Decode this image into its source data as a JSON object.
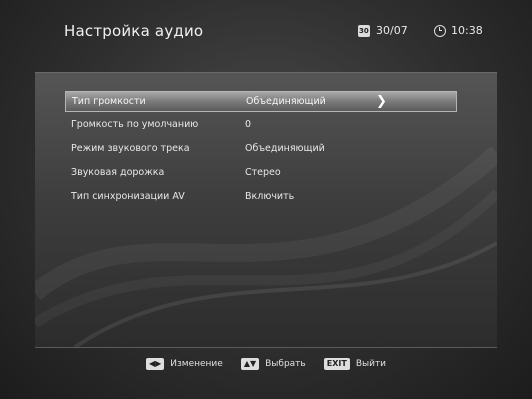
{
  "header": {
    "title": "Настройка аудио",
    "date": "30/07",
    "time": "10:38"
  },
  "menu": {
    "rows": [
      {
        "label": "Тип громкости",
        "value": "Объединяющий",
        "selected": true
      },
      {
        "label": "Громкость по умолчанию",
        "value": "0",
        "selected": false
      },
      {
        "label": "Режим звукового трека",
        "value": "Объединяющий",
        "selected": false
      },
      {
        "label": "Звуковая дорожка",
        "value": "Стерео",
        "selected": false
      },
      {
        "label": "Тип синхронизации AV",
        "value": "Включить",
        "selected": false
      }
    ],
    "selected_arrow": "❯"
  },
  "footer": {
    "change_key": "◀▶",
    "change_label": "Изменение",
    "select_key": "▲▼",
    "select_label": "Выбрать",
    "exit_key": "EXIT",
    "exit_label": "Выйти"
  }
}
